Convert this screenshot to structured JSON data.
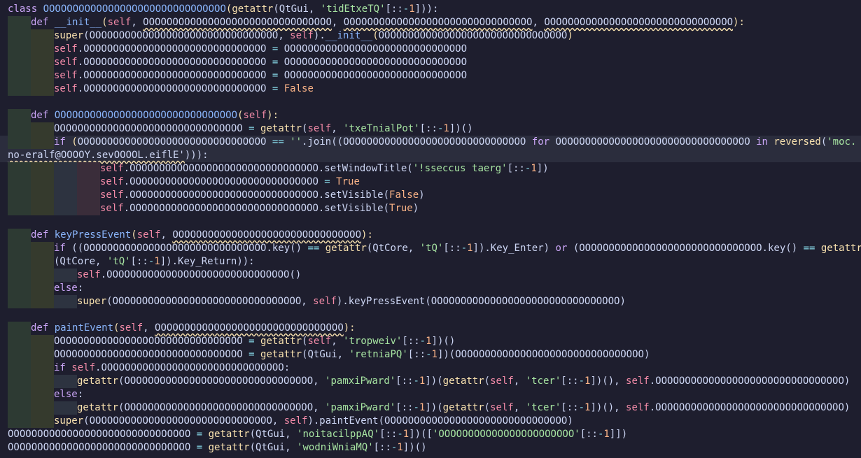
{
  "code": {
    "lines": [
      {
        "indent": 0,
        "tokens": [
          [
            "kw",
            "class "
          ],
          [
            "fn",
            "OOOOOOOOOOOOOOOOOOOOOOOOOOOOOOO"
          ],
          [
            "bi",
            "("
          ],
          [
            "bi",
            "getattr"
          ],
          [
            "",
            "("
          ],
          [
            "",
            "QtGui, "
          ],
          [
            "st",
            "'tidEtxeTQ'"
          ],
          [
            "",
            "[::"
          ],
          [
            "op",
            "-"
          ],
          [
            "nm",
            "1"
          ],
          [
            "",
            "]"
          ],
          [
            "",
            "))"
          ],
          [
            "",
            ":"
          ]
        ]
      },
      {
        "indent": 1,
        "tokens": [
          [
            "kw",
            "def "
          ],
          [
            "fn",
            "__init__"
          ],
          [
            "bi",
            "("
          ],
          [
            "sf",
            "self"
          ],
          [
            "",
            ", "
          ],
          [
            "sq",
            "OOOOOOOOOOOOOOOOOOOOOOOOOOOOOOOO"
          ],
          [
            "",
            ", "
          ],
          [
            "sq",
            "OOOOOOOOOOOOOOOOOOOOOOOOOOOOOOOO"
          ],
          [
            "",
            ", "
          ],
          [
            "sq",
            "OOOOOOOOOOOOOOOOOOOOOOOOOOOOOOOO"
          ],
          [
            "bi",
            "):"
          ]
        ]
      },
      {
        "indent": 2,
        "tokens": [
          [
            "bi",
            "super"
          ],
          [
            "",
            "("
          ],
          [
            "",
            "OOOOOOOOOOOOOOOOOOOOOOOOOOOOOOOO, "
          ],
          [
            "sf",
            "self"
          ],
          [
            "",
            ")."
          ],
          [
            "fn",
            "__init__"
          ],
          [
            "bi",
            "("
          ],
          [
            "",
            "OOOOOOOOOOOOOOOOOOOOOOOOOOOOOOOO"
          ],
          [
            "bi",
            ")"
          ]
        ]
      },
      {
        "indent": 2,
        "tokens": [
          [
            "sf",
            "self"
          ],
          [
            "",
            ".OOOOOOOOOOOOOOOOOOOOOOOOOOOOOOO "
          ],
          [
            "op",
            "="
          ],
          [
            "",
            " OOOOOOOOOOOOOOOOOOOOOOOOOOOOOOO"
          ]
        ]
      },
      {
        "indent": 2,
        "tokens": [
          [
            "sf",
            "self"
          ],
          [
            "",
            ".OOOOOOOOOOOOOOOOOOOOOOOOOOOOOOO "
          ],
          [
            "op",
            "="
          ],
          [
            "",
            " OOOOOOOOOOOOOOOOOOOOOOOOOOOOOOO"
          ]
        ]
      },
      {
        "indent": 2,
        "tokens": [
          [
            "sf",
            "self"
          ],
          [
            "",
            ".OOOOOOOOOOOOOOOOOOOOOOOOOOOOOOO "
          ],
          [
            "op",
            "="
          ],
          [
            "",
            " OOOOOOOOOOOOOOOOOOOOOOOOOOOOOOO"
          ]
        ]
      },
      {
        "indent": 2,
        "tokens": [
          [
            "sf",
            "self"
          ],
          [
            "",
            ".OOOOOOOOOOOOOOOOOOOOOOOOOOOOOOO "
          ],
          [
            "op",
            "="
          ],
          [
            "nm",
            " False"
          ]
        ]
      },
      {
        "indent": 0,
        "tokens": []
      },
      {
        "indent": 1,
        "tokens": [
          [
            "kw",
            "def "
          ],
          [
            "fn",
            "OOOOOOOOOOOOOOOOOOOOOOOOOOOOOOO"
          ],
          [
            "bi",
            "("
          ],
          [
            "sf",
            "self"
          ],
          [
            "bi",
            "):"
          ]
        ]
      },
      {
        "indent": 2,
        "tokens": [
          [
            "",
            "OOOOOOOOOOOOOOOOOOOOOOOOOOOOOOOO "
          ],
          [
            "op",
            "="
          ],
          [
            "",
            " "
          ],
          [
            "bi",
            "getattr"
          ],
          [
            "",
            "("
          ],
          [
            "sf",
            "self"
          ],
          [
            "",
            ", "
          ],
          [
            "st",
            "'txeTnialPot'"
          ],
          [
            "",
            "[::"
          ],
          [
            "op",
            "-"
          ],
          [
            "nm",
            "1"
          ],
          [
            "",
            "])()"
          ]
        ]
      },
      {
        "indent": 2,
        "hl": true,
        "tokens": [
          [
            "kw",
            "if "
          ],
          [
            "bi",
            "("
          ],
          [
            "",
            "OOOOOOOOOOOOOOOOOOOOOOOOOOOOOOOO "
          ],
          [
            "op",
            "=="
          ],
          [
            "",
            " "
          ],
          [
            "st",
            "''"
          ],
          [
            "",
            ".join(("
          ],
          [
            "",
            "OOOOOOOOOOOOOOOOOOOOOOOOOOOOOOO "
          ],
          [
            "kw",
            "for "
          ],
          [
            "",
            "OOOOOOOOOOOOOOOOOOOOOOOOOOOOOOOOO "
          ],
          [
            "kw",
            "in "
          ],
          [
            "bi",
            "reversed"
          ],
          [
            "",
            "("
          ],
          [
            "st",
            "'moc."
          ]
        ]
      },
      {
        "indent": 0,
        "hl": true,
        "tokens": [
          [
            "sq",
            "no-eralf@OOOOY.sevOOOOL.eiflE'"
          ],
          [
            "",
            "))):"
          ]
        ]
      },
      {
        "indent": 4,
        "tokens": [
          [
            "sf",
            "self"
          ],
          [
            "",
            ".OOOOOOOOOOOOOOOOOOOOOOOOOOOOOOOO.setWindowTitle("
          ],
          [
            "st",
            "'!sseccus taerg'"
          ],
          [
            "",
            "[::"
          ],
          [
            "op",
            "-"
          ],
          [
            "nm",
            "1"
          ],
          [
            "",
            "])"
          ]
        ]
      },
      {
        "indent": 4,
        "tokens": [
          [
            "sf",
            "self"
          ],
          [
            "",
            ".OOOOOOOOOOOOOOOOOOOOOOOOOOOOOOOO "
          ],
          [
            "op",
            "="
          ],
          [
            "nm",
            " True"
          ]
        ]
      },
      {
        "indent": 4,
        "tokens": [
          [
            "sf",
            "self"
          ],
          [
            "",
            ".OOOOOOOOOOOOOOOOOOOOOOOOOOOOOOOO.setVisible("
          ],
          [
            "nm",
            "False"
          ],
          [
            "",
            ")"
          ]
        ]
      },
      {
        "indent": 4,
        "tokens": [
          [
            "sf",
            "self"
          ],
          [
            "",
            ".OOOOOOOOOOOOOOOOOOOOOOOOOOOOOOOO.setVisible("
          ],
          [
            "nm",
            "True"
          ],
          [
            "",
            ")"
          ]
        ]
      },
      {
        "indent": 0,
        "tokens": []
      },
      {
        "indent": 1,
        "tokens": [
          [
            "kw",
            "def "
          ],
          [
            "fn",
            "keyPressEvent"
          ],
          [
            "bi",
            "("
          ],
          [
            "sf",
            "self"
          ],
          [
            "",
            ", "
          ],
          [
            "sq",
            "OOOOOOOOOOOOOOOOOOOOOOOOOOOOOOOO"
          ],
          [
            "bi",
            "):"
          ]
        ]
      },
      {
        "indent": 2,
        "tokens": [
          [
            "kw",
            "if "
          ],
          [
            "",
            "(("
          ],
          [
            "",
            "OOOOOOOOOOOOOOOOOOOOOOOOOOOOOOO.key() "
          ],
          [
            "op",
            "=="
          ],
          [
            "",
            " "
          ],
          [
            "bi",
            "getattr"
          ],
          [
            "",
            "(QtCore, "
          ],
          [
            "st",
            "'tQ'"
          ],
          [
            "",
            "[::"
          ],
          [
            "op",
            "-"
          ],
          [
            "nm",
            "1"
          ],
          [
            "",
            "]).Key_Enter) "
          ],
          [
            "kw",
            "or "
          ],
          [
            "",
            "(OOOOOOOOOOOOOOOOOOOOOOOOOOOOOOO.key() "
          ],
          [
            "op",
            "=="
          ],
          [
            "",
            " "
          ],
          [
            "bi",
            "getattr"
          ]
        ]
      },
      {
        "indent": 2,
        "tokens": [
          [
            "",
            "(QtCore, "
          ],
          [
            "st",
            "'tQ'"
          ],
          [
            "",
            "[::"
          ],
          [
            "op",
            "-"
          ],
          [
            "nm",
            "1"
          ],
          [
            "",
            "]).Key_Return)):"
          ]
        ]
      },
      {
        "indent": 3,
        "tokens": [
          [
            "sf",
            "self"
          ],
          [
            "",
            ".OOOOOOOOOOOOOOOOOOOOOOOOOOOOOOO()"
          ]
        ]
      },
      {
        "indent": 2,
        "tokens": [
          [
            "kw",
            "else"
          ],
          [
            "",
            ":"
          ]
        ]
      },
      {
        "indent": 3,
        "tokens": [
          [
            "bi",
            "super"
          ],
          [
            "",
            "(OOOOOOOOOOOOOOOOOOOOOOOOOOOOOOOO, "
          ],
          [
            "sf",
            "self"
          ],
          [
            "",
            ").keyPressEvent(OOOOOOOOOOOOOOOOOOOOOOOOOOOOOOOO)"
          ]
        ]
      },
      {
        "indent": 0,
        "tokens": []
      },
      {
        "indent": 1,
        "tokens": [
          [
            "kw",
            "def "
          ],
          [
            "fn",
            "paintEvent"
          ],
          [
            "bi",
            "("
          ],
          [
            "sf",
            "self"
          ],
          [
            "",
            ", "
          ],
          [
            "sq",
            "OOOOOOOOOOOOOOOOOOOOOOOOOOOOOOOO"
          ],
          [
            "bi",
            "):"
          ]
        ]
      },
      {
        "indent": 2,
        "tokens": [
          [
            "",
            "OOOOOOOOOOOOOOOOOOOOOOOOOOOOOOOO "
          ],
          [
            "op",
            "="
          ],
          [
            "",
            " "
          ],
          [
            "bi",
            "getattr"
          ],
          [
            "",
            "("
          ],
          [
            "sf",
            "self"
          ],
          [
            "",
            ", "
          ],
          [
            "st",
            "'tropweiv'"
          ],
          [
            "",
            "[::"
          ],
          [
            "op",
            "-"
          ],
          [
            "nm",
            "1"
          ],
          [
            "",
            "])()"
          ]
        ]
      },
      {
        "indent": 2,
        "tokens": [
          [
            "",
            "OOOOOOOOOOOOOOOOOOOOOOOOOOOOOOOO "
          ],
          [
            "op",
            "="
          ],
          [
            "",
            " "
          ],
          [
            "bi",
            "getattr"
          ],
          [
            "",
            "(QtGui, "
          ],
          [
            "st",
            "'retniaPQ'"
          ],
          [
            "",
            "[::"
          ],
          [
            "op",
            "-"
          ],
          [
            "nm",
            "1"
          ],
          [
            "",
            "])(OOOOOOOOOOOOOOOOOOOOOOOOOOOOOOOO)"
          ]
        ]
      },
      {
        "indent": 2,
        "tokens": [
          [
            "kw",
            "if "
          ],
          [
            "sf",
            "self"
          ],
          [
            "",
            ".OOOOOOOOOOOOOOOOOOOOOOOOOOOOOOO:"
          ]
        ]
      },
      {
        "indent": 3,
        "tokens": [
          [
            "bi",
            "getattr"
          ],
          [
            "",
            "(OOOOOOOOOOOOOOOOOOOOOOOOOOOOOOOO, "
          ],
          [
            "st",
            "'pamxiPward'"
          ],
          [
            "",
            "[::"
          ],
          [
            "op",
            "-"
          ],
          [
            "nm",
            "1"
          ],
          [
            "",
            "])("
          ],
          [
            "bi",
            "getattr"
          ],
          [
            "",
            "("
          ],
          [
            "sf",
            "self"
          ],
          [
            "",
            ", "
          ],
          [
            "st",
            "'tcer'"
          ],
          [
            "",
            "[::"
          ],
          [
            "op",
            "-"
          ],
          [
            "nm",
            "1"
          ],
          [
            "",
            "])(), "
          ],
          [
            "sf",
            "self"
          ],
          [
            "",
            ".OOOOOOOOOOOOOOOOOOOOOOOOOOOOOOOO)"
          ]
        ]
      },
      {
        "indent": 2,
        "tokens": [
          [
            "kw",
            "else"
          ],
          [
            "",
            ":"
          ]
        ]
      },
      {
        "indent": 3,
        "tokens": [
          [
            "bi",
            "getattr"
          ],
          [
            "",
            "(OOOOOOOOOOOOOOOOOOOOOOOOOOOOOOOO, "
          ],
          [
            "st",
            "'pamxiPward'"
          ],
          [
            "",
            "[::"
          ],
          [
            "op",
            "-"
          ],
          [
            "nm",
            "1"
          ],
          [
            "",
            "])("
          ],
          [
            "bi",
            "getattr"
          ],
          [
            "",
            "("
          ],
          [
            "sf",
            "self"
          ],
          [
            "",
            ", "
          ],
          [
            "st",
            "'tcer'"
          ],
          [
            "",
            "[::"
          ],
          [
            "op",
            "-"
          ],
          [
            "nm",
            "1"
          ],
          [
            "",
            "])(), "
          ],
          [
            "sf",
            "self"
          ],
          [
            "",
            ".OOOOOOOOOOOOOOOOOOOOOOOOOOOOOOOO)"
          ]
        ]
      },
      {
        "indent": 2,
        "tokens": [
          [
            "bi",
            "super"
          ],
          [
            "",
            "(OOOOOOOOOOOOOOOOOOOOOOOOOOOOOOO, "
          ],
          [
            "sf",
            "self"
          ],
          [
            "",
            ").paintEvent(OOOOOOOOOOOOOOOOOOOOOOOOOOOOOOO)"
          ]
        ]
      },
      {
        "indent": 0,
        "tokens": [
          [
            "",
            "OOOOOOOOOOOOOOOOOOOOOOOOOOOOOOO "
          ],
          [
            "op",
            "="
          ],
          [
            "",
            " "
          ],
          [
            "bi",
            "getattr"
          ],
          [
            "",
            "(QtGui, "
          ],
          [
            "st",
            "'noitacilppAQ'"
          ],
          [
            "",
            "[::"
          ],
          [
            "op",
            "-"
          ],
          [
            "nm",
            "1"
          ],
          [
            "",
            "])(["
          ],
          [
            "st",
            "'OOOOOOOOOOOOOOOOOOOOOOO'"
          ],
          [
            "",
            "[::"
          ],
          [
            "op",
            "-"
          ],
          [
            "nm",
            "1"
          ],
          [
            "",
            "]])"
          ]
        ]
      },
      {
        "indent": 0,
        "tokens": [
          [
            "",
            "OOOOOOOOOOOOOOOOOOOOOOOOOOOOOOO "
          ],
          [
            "op",
            "="
          ],
          [
            "",
            " "
          ],
          [
            "bi",
            "getattr"
          ],
          [
            "",
            "(QtGui, "
          ],
          [
            "st",
            "'wodniWniaMQ'"
          ],
          [
            "",
            "[::"
          ],
          [
            "op",
            "-"
          ],
          [
            "nm",
            "1"
          ],
          [
            "",
            "])()"
          ]
        ]
      }
    ]
  }
}
